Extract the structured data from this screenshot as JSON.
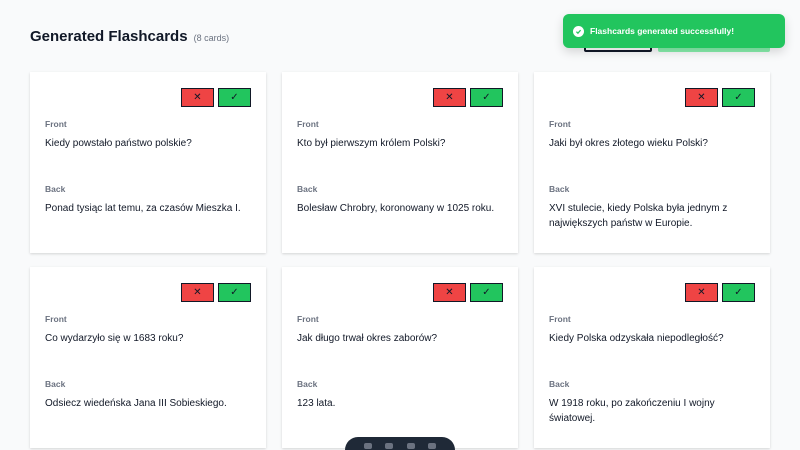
{
  "header": {
    "title": "Generated Flashcards",
    "count": "(8 cards)"
  },
  "toast": {
    "message": "Flashcards generated successfully!"
  },
  "card_labels": {
    "front": "Front",
    "back": "Back",
    "reject": "✕",
    "accept": "✓"
  },
  "cards": [
    {
      "front": "Kiedy powstało państwo polskie?",
      "back": "Ponad tysiąc lat temu, za czasów Mieszka I."
    },
    {
      "front": "Kto był pierwszym królem Polski?",
      "back": "Bolesław Chrobry, koronowany w 1025 roku."
    },
    {
      "front": "Jaki był okres złotego wieku Polski?",
      "back": "XVI stulecie, kiedy Polska była jednym z największych państw w Europie."
    },
    {
      "front": "Co wydarzyło się w 1683 roku?",
      "back": "Odsiecz wiedeńska Jana III Sobieskiego."
    },
    {
      "front": "Jak długo trwał okres zaborów?",
      "back": "123 lata."
    },
    {
      "front": "Kiedy Polska odzyskała niepodległość?",
      "back": "W 1918 roku, po zakończeniu I wojny światowej."
    }
  ],
  "colors": {
    "accent": "#22c55e",
    "reject": "#ef4444"
  }
}
